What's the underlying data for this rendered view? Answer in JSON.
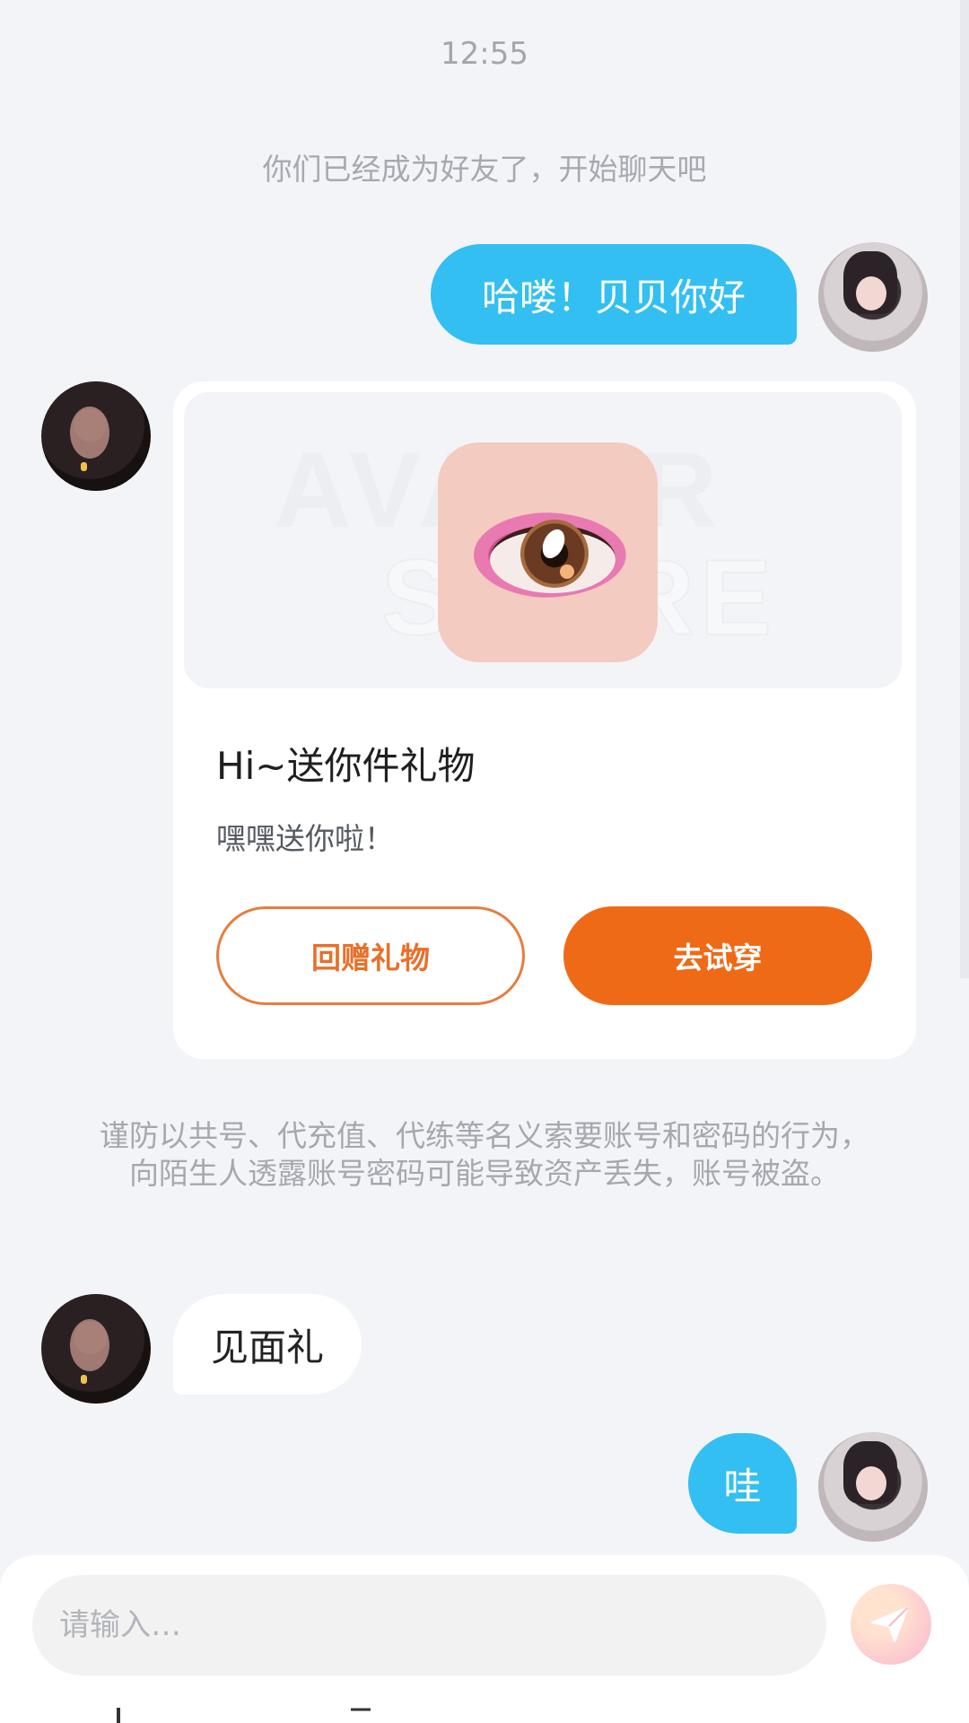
{
  "chat": {
    "time": "12:55",
    "friend_notice": "你们已经成为好友了，开始聊天吧",
    "warning": "谨防以共号、代充值、代练等名义索要账号和密码的行为，向陌生人透露账号密码可能导致资产丢失，账号被盗。",
    "messages": {
      "m1": "哈喽！贝贝你好",
      "m2": "见面礼",
      "m3": "哇"
    },
    "gift_card": {
      "title": "Hi~送你件礼物",
      "description": "嘿嘿送你啦！",
      "return_button": "回赠礼物",
      "try_button": "去试穿"
    }
  },
  "input": {
    "placeholder": "请输入…"
  },
  "colors": {
    "my_bubble": "#33bff1",
    "primary_orange": "#ef6a17",
    "background": "#f3f4f8"
  },
  "icons": {
    "send": "paper-plane-icon"
  }
}
